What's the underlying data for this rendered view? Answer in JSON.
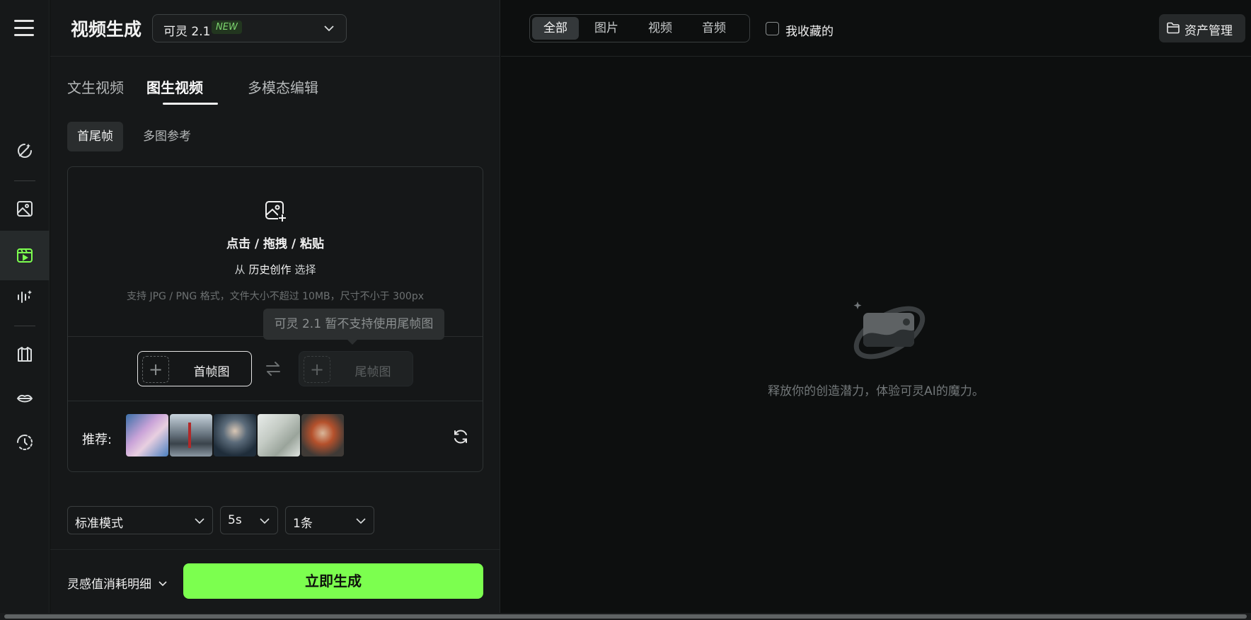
{
  "header": {
    "title": "视频生成",
    "model": "可灵 2.1",
    "model_badge": "NEW"
  },
  "tabs": [
    "文生视频",
    "图生视频",
    "多模态编辑"
  ],
  "sub_tabs": [
    "首尾帧",
    "多图参考"
  ],
  "upload": {
    "title": "点击 / 拖拽 / 粘贴",
    "from_prefix": "从",
    "history_link": "历史创作",
    "from_suffix": "选择",
    "hint": "支持 JPG / PNG 格式，文件大小不超过 10MB，尺寸不小于 300px"
  },
  "tooltip": "可灵 2.1 暂不支持使用尾帧图",
  "frames": {
    "first": "首帧图",
    "last": "尾帧图"
  },
  "recommend": {
    "label": "推荐:"
  },
  "options": {
    "mode": "标准模式",
    "duration": "5s",
    "count": "1条"
  },
  "footer": {
    "cost_detail": "灵感值消耗明细",
    "generate": "立即生成"
  },
  "filters": [
    "全部",
    "图片",
    "视频",
    "音频"
  ],
  "favorites": "我收藏的",
  "asset_manage": "资产管理",
  "empty_state": "释放你的创造潜力，体验可灵AI的魔力。",
  "colors": {
    "accent": "#7cff4f",
    "background": "#0d0f0f",
    "panel": "#161819"
  }
}
